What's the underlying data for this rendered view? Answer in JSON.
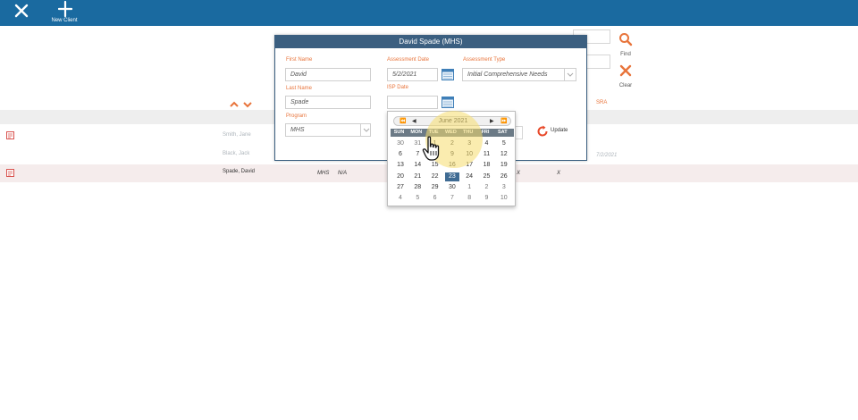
{
  "toolbar": {
    "close_icon": "close-icon",
    "new_client_label": "New Client"
  },
  "actions": {
    "find_label": "Find",
    "clear_label": "Clear"
  },
  "columns": {
    "sra": "SRA"
  },
  "rows": [
    {
      "name": "Smith, Jane",
      "program": "",
      "isp": "",
      "date": ""
    },
    {
      "name": "Black, Jack",
      "program": "",
      "isp": "",
      "date": "7/2/2021"
    },
    {
      "name": "Spade, David",
      "program": "MHS",
      "isp": "N/A",
      "mark1": "X",
      "mark2": "X"
    }
  ],
  "modal": {
    "title": "David Spade (MHS)",
    "first_name_label": "First Name",
    "first_name_value": "David",
    "last_name_label": "Last Name",
    "last_name_value": "Spade",
    "program_label": "Program",
    "program_value": "MHS",
    "assessment_date_label": "Assessment Date",
    "assessment_date_value": "5/2/2021",
    "isp_date_label": "ISP Date",
    "isp_date_value": "",
    "assessment_type_label": "Assessment Type",
    "assessment_type_value": "Initial Comprehensive Needs",
    "update_label": "Update"
  },
  "datepicker": {
    "month_label": "June 2021",
    "nav": {
      "prev_year": "⏪",
      "prev_month": "◀",
      "next_month": "▶",
      "next_year": "⏩"
    },
    "weekdays": [
      "SUN",
      "MON",
      "TUE",
      "WED",
      "THU",
      "FRI",
      "SAT"
    ],
    "weeks": [
      [
        "30",
        "31",
        "1",
        "2",
        "3",
        "4",
        "5"
      ],
      [
        "6",
        "7",
        "8",
        "9",
        "10",
        "11",
        "12"
      ],
      [
        "13",
        "14",
        "15",
        "16",
        "17",
        "18",
        "19"
      ],
      [
        "20",
        "21",
        "22",
        "23",
        "24",
        "25",
        "26"
      ],
      [
        "27",
        "28",
        "29",
        "30",
        "1",
        "2",
        "3"
      ],
      [
        "4",
        "5",
        "6",
        "7",
        "8",
        "9",
        "10"
      ]
    ],
    "other_month": [
      [
        true,
        true,
        false,
        false,
        false,
        false,
        false
      ],
      [
        false,
        false,
        false,
        false,
        false,
        false,
        false
      ],
      [
        false,
        false,
        false,
        false,
        false,
        false,
        false
      ],
      [
        false,
        false,
        false,
        false,
        false,
        false,
        false
      ],
      [
        false,
        false,
        false,
        false,
        true,
        true,
        true
      ],
      [
        true,
        true,
        true,
        true,
        true,
        true,
        true
      ]
    ],
    "selected": "23"
  },
  "colors": {
    "topbar": "#1a6aa0",
    "modal_header": "#3b5f80",
    "accent_orange": "#e8743b",
    "selected_day": "#3f6b93"
  }
}
